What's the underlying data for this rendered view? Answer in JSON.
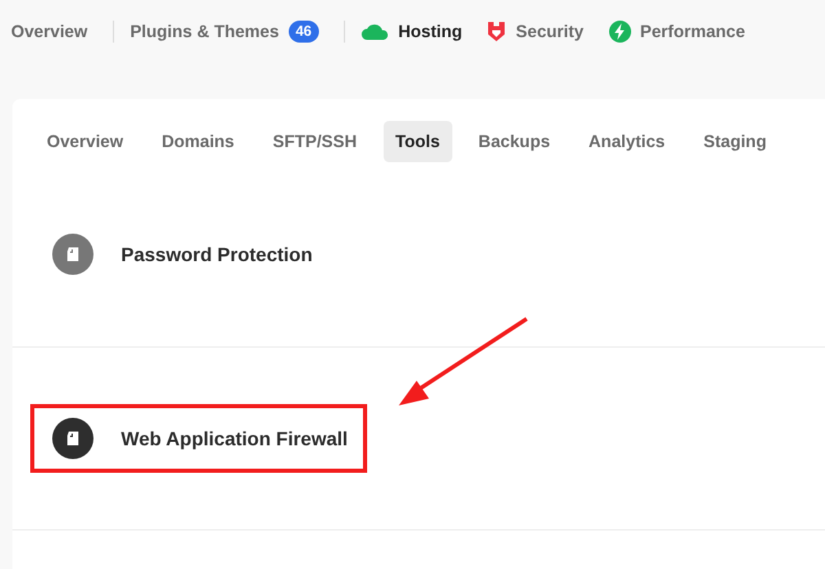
{
  "top_nav": [
    {
      "label": "Overview",
      "selected": false
    },
    {
      "label": "Plugins & Themes",
      "selected": false,
      "badge": "46"
    },
    {
      "label": "Hosting",
      "selected": true
    },
    {
      "label": "Security",
      "selected": false
    },
    {
      "label": "Performance",
      "selected": false
    }
  ],
  "tabs": [
    {
      "label": "Overview",
      "selected": false
    },
    {
      "label": "Domains",
      "selected": false
    },
    {
      "label": "SFTP/SSH",
      "selected": false
    },
    {
      "label": "Tools",
      "selected": true
    },
    {
      "label": "Backups",
      "selected": false
    },
    {
      "label": "Analytics",
      "selected": false
    },
    {
      "label": "Staging",
      "selected": false
    }
  ],
  "tools": [
    {
      "name": "Password Protection",
      "highlighted": false
    },
    {
      "name": "Web Application Firewall",
      "highlighted": true
    }
  ]
}
